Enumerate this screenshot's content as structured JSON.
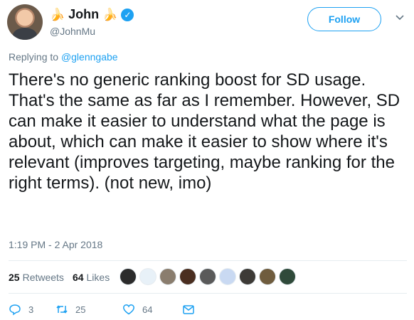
{
  "author": {
    "name": "John",
    "handle": "@JohnMu",
    "banana_glyph": "🍌",
    "verified_glyph": "✓"
  },
  "follow_label": "Follow",
  "reply": {
    "prefix": "Replying to ",
    "mention": "@glenngabe"
  },
  "text": "There's no generic ranking boost for SD usage. That's the same as far as I remember. However, SD can make it easier to understand what the page is about, which can make it easier to show where it's relevant (improves targeting, maybe ranking for the right terms). (not new, imo)",
  "timestamp": "1:19 PM - 2 Apr 2018",
  "stats": {
    "retweets_count": "25",
    "retweets_label": "Retweets",
    "likes_count": "64",
    "likes_label": "Likes"
  },
  "likers": [
    {
      "color": "#2b2b2b"
    },
    {
      "color": "#e8f1f8"
    },
    {
      "color": "#8a7d6e"
    },
    {
      "color": "#4a2e20"
    },
    {
      "color": "#5a5a5a"
    },
    {
      "color": "#c9d9f2"
    },
    {
      "color": "#3d3a36"
    },
    {
      "color": "#6f5c3e"
    },
    {
      "color": "#2f4a3a"
    }
  ],
  "actions": {
    "reply_count": "3",
    "retweet_count": "25",
    "like_count": "64"
  },
  "colors": {
    "accent": "#1da1f2",
    "text": "#14171a",
    "muted": "#657786"
  }
}
